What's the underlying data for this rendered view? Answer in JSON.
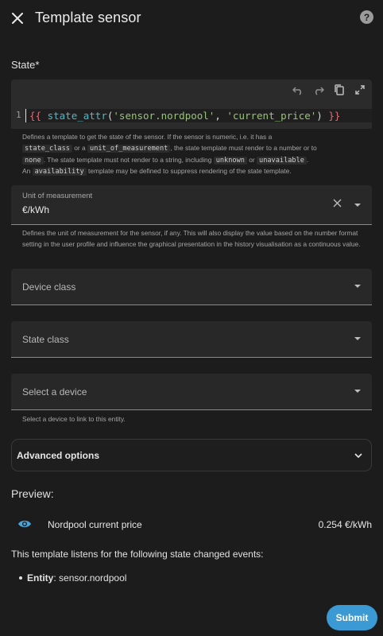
{
  "header": {
    "title": "Template sensor",
    "help_label": "?"
  },
  "state": {
    "label": "State*",
    "line_number": "1",
    "code_tokens": [
      "{{",
      "state_attr",
      "(",
      "'sensor.nordpool'",
      ", ",
      "'current_price'",
      ")",
      "}}"
    ],
    "helper_parts": {
      "p1": "Defines a template to get the state of the sensor. If the sensor is numeric, i.e. it has a",
      "c1": "state_class",
      "p2": "or a",
      "c2": "unit_of_measurement",
      "p3": ", the state template must render to a number or to",
      "c3": "none",
      "p4": ". The state template must not render to a string, including",
      "c4": "unknown",
      "p5": "or",
      "c5": "unavailable",
      "p6": ".",
      "p7": "An",
      "c6": "availability",
      "p8": "template may be defined to suppress rendering of the state template."
    }
  },
  "unit": {
    "label": "Unit of measurement",
    "value": "€/kWh",
    "helper": "Defines the unit of measurement for the sensor, if any. This will also display the value based on the number format setting in the user profile and influence the graphical presentation in the history visualisation as a continuous value."
  },
  "device_class": {
    "placeholder": "Device class"
  },
  "state_class": {
    "placeholder": "State class"
  },
  "device": {
    "placeholder": "Select a device",
    "helper": "Select a device to link to this entity."
  },
  "advanced": {
    "label": "Advanced options"
  },
  "preview": {
    "title": "Preview:",
    "entity_name": "Nordpool current price",
    "entity_value": "0.254 €/kWh",
    "listens_text": "This template listens for the following state changed events:",
    "entity_label": "Entity",
    "entity_id": "sensor.nordpool"
  },
  "footer": {
    "submit_label": "Submit"
  },
  "icons": [
    "close-icon",
    "help-icon",
    "undo-icon",
    "redo-icon",
    "copy-icon",
    "fullscreen-icon",
    "clear-icon",
    "chevron-down-icon",
    "eye-icon"
  ],
  "colors": {
    "accent": "#3b9ad4",
    "background": "#1c1c1c",
    "field": "#282828"
  }
}
